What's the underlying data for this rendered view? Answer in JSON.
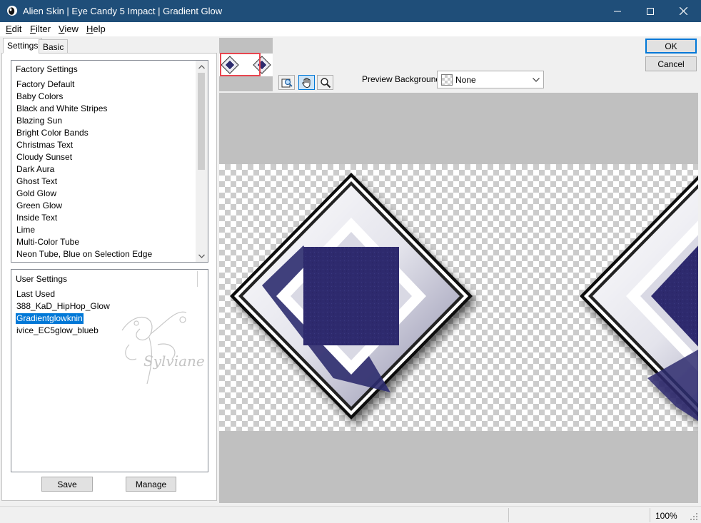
{
  "window": {
    "title": "Alien Skin | Eye Candy 5 Impact | Gradient Glow",
    "controls": [
      "minimize",
      "maximize",
      "close"
    ]
  },
  "menu": [
    {
      "label": "Edit",
      "key": "E",
      "rest": "dit"
    },
    {
      "label": "Filter",
      "key": "F",
      "rest": "ilter"
    },
    {
      "label": "View",
      "key": "V",
      "rest": "iew"
    },
    {
      "label": "Help",
      "key": "H",
      "rest": "elp"
    }
  ],
  "tabs": {
    "settings": "Settings",
    "basic": "Basic"
  },
  "factory": {
    "header": "Factory Settings",
    "items": [
      "Factory Default",
      "Baby Colors",
      "Black and White Stripes",
      "Blazing Sun",
      "Bright Color Bands",
      "Christmas Text",
      "Cloudy Sunset",
      "Dark Aura",
      "Ghost Text",
      "Gold Glow",
      "Green Glow",
      "Inside Text",
      "Lime",
      "Multi-Color Tube",
      "Neon Tube, Blue on Selection Edge"
    ],
    "scroll_position": 0.0,
    "scroll_visible_fraction": 0.55
  },
  "user": {
    "header": "User Settings",
    "items": [
      "Last Used",
      "388_KaD_HipHop_Glow",
      "Gradientglowknin",
      "ivice_EC5glow_blueb"
    ],
    "selected_index": 2
  },
  "buttons": {
    "save": "Save",
    "manage": "Manage",
    "ok": "OK",
    "cancel": "Cancel"
  },
  "preview": {
    "background_label": "Preview Background:",
    "background_value": "None",
    "tools": [
      "zoom-fit-icon",
      "hand-icon",
      "magnifier-icon"
    ],
    "active_tool": "hand-icon",
    "tile_color": "#2e2c6e"
  },
  "status": {
    "zoom": "100%"
  }
}
